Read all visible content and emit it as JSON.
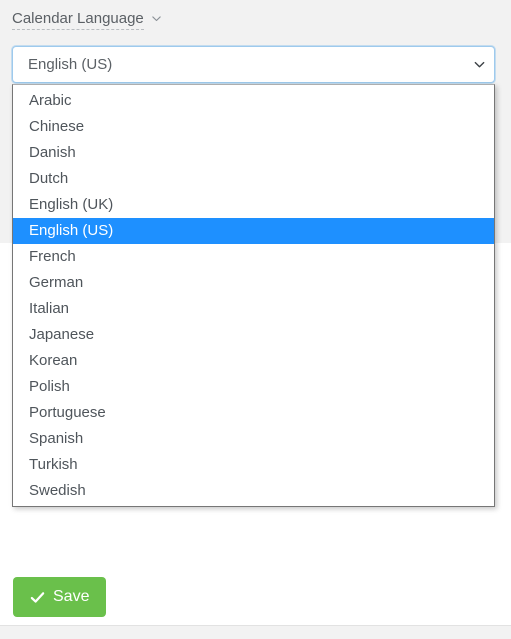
{
  "page": {
    "background_color": "#f2f2f2",
    "panel_background_color": "#ffffff"
  },
  "field": {
    "label": "Calendar Language",
    "label_icon": "chevron-down-icon",
    "has_dashed_underline": true
  },
  "select": {
    "name": "calendar-language-select",
    "selected_value": "English (US)",
    "expanded": true,
    "arrow_icon": "chevron-down-icon",
    "focus_ring_color": "#9ecaed",
    "highlight_color": "#1e90ff",
    "options": [
      {
        "label": "Arabic",
        "selected": false
      },
      {
        "label": "Chinese",
        "selected": false
      },
      {
        "label": "Danish",
        "selected": false
      },
      {
        "label": "Dutch",
        "selected": false
      },
      {
        "label": "English (UK)",
        "selected": false
      },
      {
        "label": "English (US)",
        "selected": true
      },
      {
        "label": "French",
        "selected": false
      },
      {
        "label": "German",
        "selected": false
      },
      {
        "label": "Italian",
        "selected": false
      },
      {
        "label": "Japanese",
        "selected": false
      },
      {
        "label": "Korean",
        "selected": false
      },
      {
        "label": "Polish",
        "selected": false
      },
      {
        "label": "Portuguese",
        "selected": false
      },
      {
        "label": "Spanish",
        "selected": false
      },
      {
        "label": "Turkish",
        "selected": false
      },
      {
        "label": "Swedish",
        "selected": false
      }
    ]
  },
  "occluded_field": {
    "label": ""
  },
  "actions": {
    "save_label": "Save",
    "save_icon": "check-icon",
    "save_color": "#6ac04b"
  }
}
